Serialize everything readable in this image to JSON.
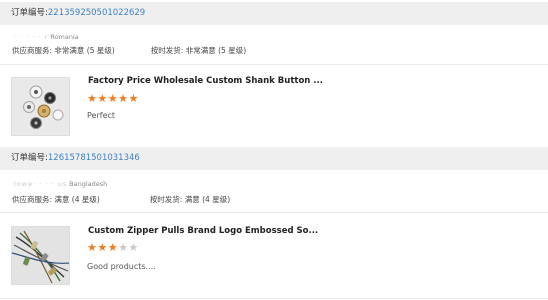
{
  "orders": [
    {
      "label": "订单编号:",
      "number": "221359250501022629",
      "buyer_name_masked": "· · · · · r",
      "buyer_country": "Romania",
      "supplier_service": "供应商服务: 非常满意 (5 星级)",
      "delivery": "按时发货: 非常满意 (5 星级)",
      "product_title": "Factory Price Wholesale Custom Shank Button ...",
      "rating": 5,
      "review": "Perfect"
    },
    {
      "label": "订单编号:",
      "number": "12615781501031346",
      "buyer_name_masked": "lowe· · · · us",
      "buyer_country": "Bangladesh",
      "supplier_service": "供应商服务: 满意 (4 星级)",
      "delivery": "按时发货: 满意 (4 星级)",
      "product_title": "Custom Zipper Pulls Brand Logo Embossed So...",
      "rating": 3,
      "review": "Good products...."
    }
  ],
  "colors": {
    "star_on": "#f07c1e",
    "star_off": "#c8c8c8",
    "order_number": "#3f82c4"
  }
}
